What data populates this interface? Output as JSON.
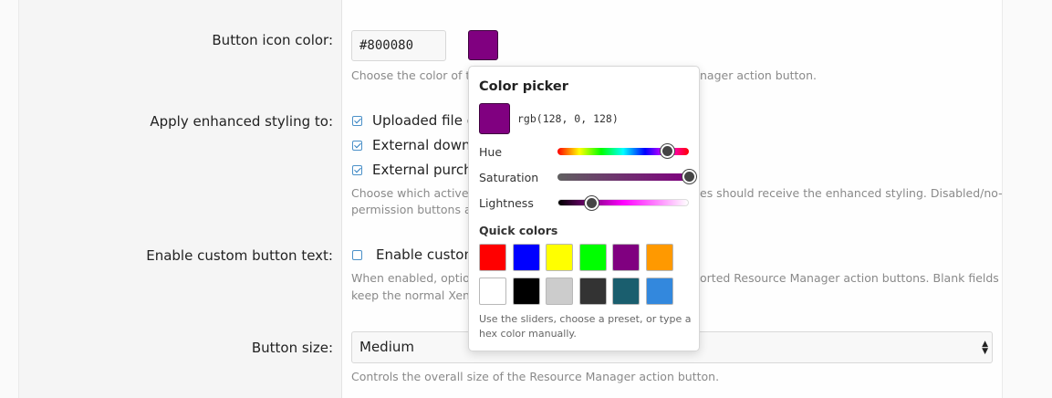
{
  "form": {
    "icon_color_label": "Button icon color:",
    "icon_color_value": "#800080",
    "icon_color_help_left": "Choose the color of th",
    "icon_color_help_right": "nager action button.",
    "styling_label": "Apply enhanced styling to:",
    "styling_options": [
      {
        "label": "Uploaded file do",
        "checked": true
      },
      {
        "label": "External downlo",
        "checked": true
      },
      {
        "label": "External purchas",
        "checked": true
      }
    ],
    "styling_help_line1_left": "Choose which active X",
    "styling_help_line1_right": "es should receive the enhanced styling. Disabled/no-",
    "styling_help_line2_left": "permission buttons are",
    "custom_text_label": "Enable custom button text:",
    "custom_text_option": "Enable custom",
    "custom_text_checked": false,
    "custom_text_help_line1_left": "When enabled, option",
    "custom_text_help_line1_right": "orted Resource Manager action buttons. Blank fields",
    "custom_text_help_line2_left": "keep the normal XenFo",
    "size_label": "Button size:",
    "size_value": "Medium",
    "size_arrow": "▲\n▼",
    "size_help": "Controls the overall size of the Resource Manager action button."
  },
  "picker": {
    "title": "Color picker",
    "preview_color": "#800080",
    "rgb_text": "rgb(128, 0, 128)",
    "hue_label": "Hue",
    "hue_value": 300,
    "saturation_label": "Saturation",
    "saturation_value": 100,
    "lightness_label": "Lightness",
    "lightness_value": 25,
    "quick_title": "Quick colors",
    "quick_colors": [
      "#ff0000",
      "#0000ff",
      "#ffff00",
      "#00ff00",
      "#800080",
      "#ff9900",
      "#ffffff",
      "#000000",
      "#cccccc",
      "#333333",
      "#1a5e6e",
      "#3388dd"
    ],
    "help": "Use the sliders, choose a preset, or type a hex color manually."
  }
}
